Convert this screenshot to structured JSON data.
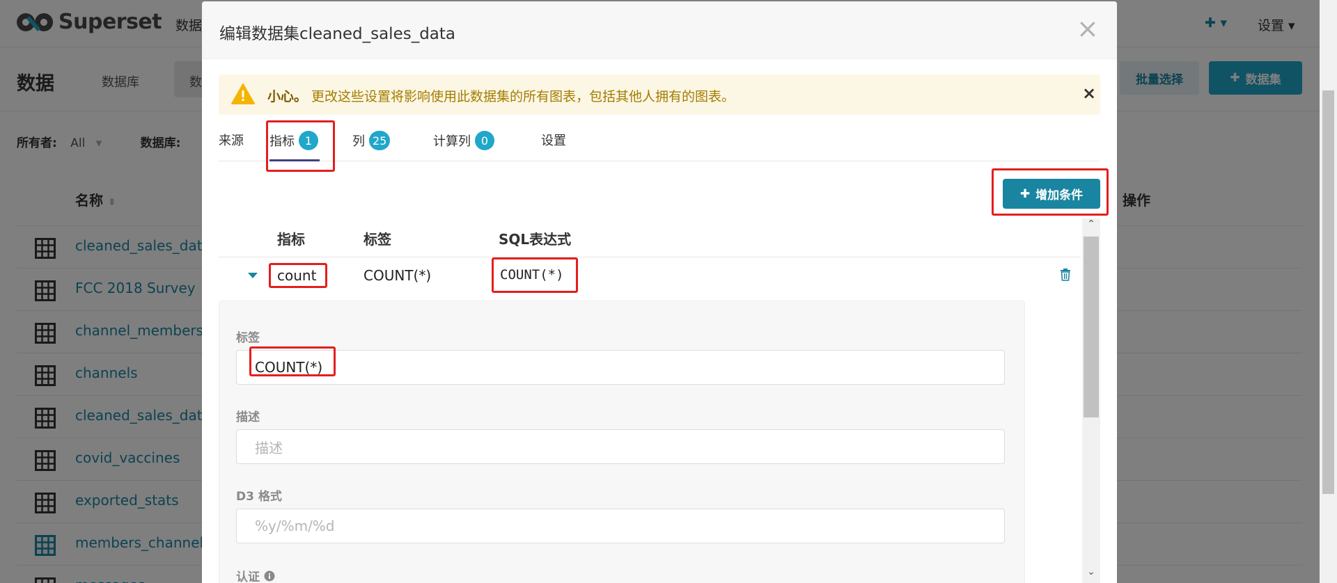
{
  "app": {
    "brand": "Superset",
    "nav_partial": "数据",
    "nav_settings": "设置"
  },
  "page": {
    "title": "数据",
    "tabs": [
      "数据库",
      "数"
    ],
    "bulk_select": "批量选择",
    "add_dataset": "数据集",
    "filters": {
      "owner_label": "所有者:",
      "owner_value": "All",
      "database_label": "数据库:"
    },
    "table": {
      "col_name": "名称",
      "col_actions": "操作",
      "rows": [
        "cleaned_sales_dat",
        "FCC 2018 Survey",
        "channel_members",
        "channels",
        "cleaned_sales_dat",
        "covid_vaccines",
        "exported_stats",
        "members_channel",
        "messages"
      ]
    }
  },
  "modal": {
    "title": "编辑数据集cleaned_sales_data",
    "alert": {
      "strong": "小心。",
      "text": "更改这些设置将影响使用此数据集的所有图表，包括其他人拥有的图表。"
    },
    "tabs": [
      {
        "label": "来源"
      },
      {
        "label": "指标",
        "badge": "1",
        "active": true
      },
      {
        "label": "列",
        "badge": "25"
      },
      {
        "label": "计算列",
        "badge": "0"
      },
      {
        "label": "设置"
      }
    ],
    "add_button": "增加条件",
    "columns": {
      "metric": "指标",
      "label": "标签",
      "sql": "SQL表达式"
    },
    "metric_row": {
      "metric": "count",
      "label": "COUNT(*)",
      "sql": "COUNT(*)"
    },
    "detail": {
      "label_title": "标签",
      "label_value": "COUNT(*)",
      "description_title": "描述",
      "description_placeholder": "描述",
      "d3_title": "D3 格式",
      "d3_placeholder": "%y/%m/%d",
      "certification_title": "认证"
    }
  },
  "colors": {
    "accent": "#1a85a0",
    "badge": "#20a7c9",
    "alert_bg": "#fcf6e4",
    "alert_text": "#a37d00",
    "highlight": "#e41e1e"
  }
}
